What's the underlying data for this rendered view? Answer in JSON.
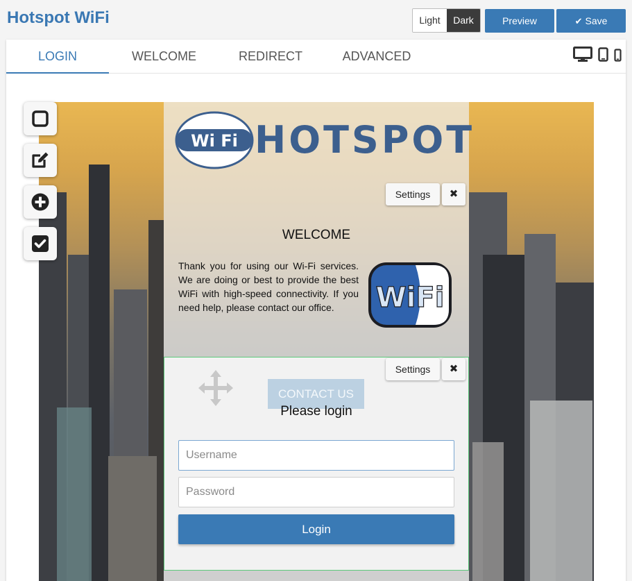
{
  "app": {
    "title": "Hotspot WiFi"
  },
  "header": {
    "theme_light": "Light",
    "theme_dark": "Dark",
    "preview_label": "Preview",
    "save_label": "Save"
  },
  "tabs": [
    {
      "label": "LOGIN",
      "active": true
    },
    {
      "label": "WELCOME",
      "active": false
    },
    {
      "label": "REDIRECT",
      "active": false
    },
    {
      "label": "ADVANCED",
      "active": false
    }
  ],
  "devices": [
    "desktop-icon",
    "tablet-icon",
    "mobile-icon"
  ],
  "tools": [
    "square-icon",
    "edit-icon",
    "add-circle-icon",
    "checkbox-icon"
  ],
  "logo": {
    "badge_text": "Wi Fi",
    "wordmark": "HOTSPOT"
  },
  "welcome_block": {
    "settings_label": "Settings",
    "close_label": "✖",
    "title": "WELCOME",
    "text": "Thank you for using our Wi-Fi services. We are doing or best to provide the best WiFi with high-speed connectivity. If you need help, please contact our office.",
    "image_text": "WiFi",
    "contact_label": "CONTACT US"
  },
  "login_block": {
    "settings_label": "Settings",
    "close_label": "✖",
    "title": "Please login",
    "username_placeholder": "Username",
    "password_placeholder": "Password",
    "login_label": "Login"
  },
  "colors": {
    "accent": "#3a7ab5",
    "title": "#3a78b3",
    "logo_blue": "#3c5f8e",
    "selection_border": "#5cc97a"
  }
}
